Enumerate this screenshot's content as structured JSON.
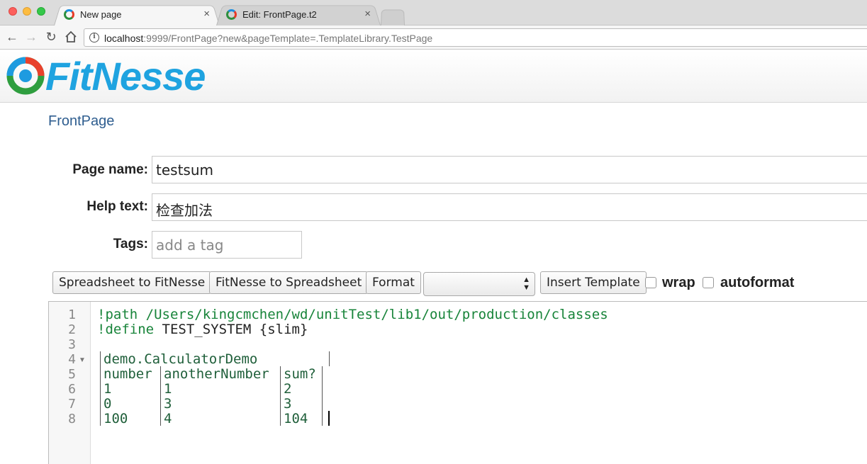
{
  "browser": {
    "tabs": [
      {
        "title": "New page",
        "active": true
      },
      {
        "title": "Edit: FrontPage.t2",
        "active": false
      }
    ],
    "close_glyph": "×",
    "url_host": "localhost",
    "url_path": ":9999/FrontPage?new&pageTemplate=.TemplateLibrary.TestPage"
  },
  "app": {
    "logo_text": "FitNesse"
  },
  "breadcrumb": "FrontPage",
  "form": {
    "page_name_label": "Page name:",
    "page_name_value": "testsum",
    "help_text_label": "Help text:",
    "help_text_value": "检查加法",
    "tags_label": "Tags:",
    "tags_placeholder": "add a tag"
  },
  "toolbar": {
    "spreadsheet_to_fitnesse": "Spreadsheet to FitNesse",
    "fitnesse_to_spreadsheet": "FitNesse to Spreadsheet",
    "format": "Format",
    "template_select_value": "",
    "insert_template": "Insert Template",
    "wrap": "wrap",
    "autoformat": "autoformat"
  },
  "editor": {
    "line_numbers": [
      "1",
      "2",
      "3",
      "4",
      "5",
      "6",
      "7",
      "8"
    ],
    "line1_kw": "!path",
    "line1_text": " /Users/kingcmchen/wd/unitTest/lib1/out/production/classes",
    "line2_kw": "!define",
    "line2_text": " TEST_SYSTEM {slim}",
    "table": {
      "title": "demo.CalculatorDemo",
      "headers": [
        "number",
        "anotherNumber",
        "sum?"
      ],
      "rows": [
        [
          "1",
          "1",
          "2"
        ],
        [
          "0",
          "3",
          "3"
        ],
        [
          "100",
          "4",
          "104"
        ]
      ]
    }
  }
}
